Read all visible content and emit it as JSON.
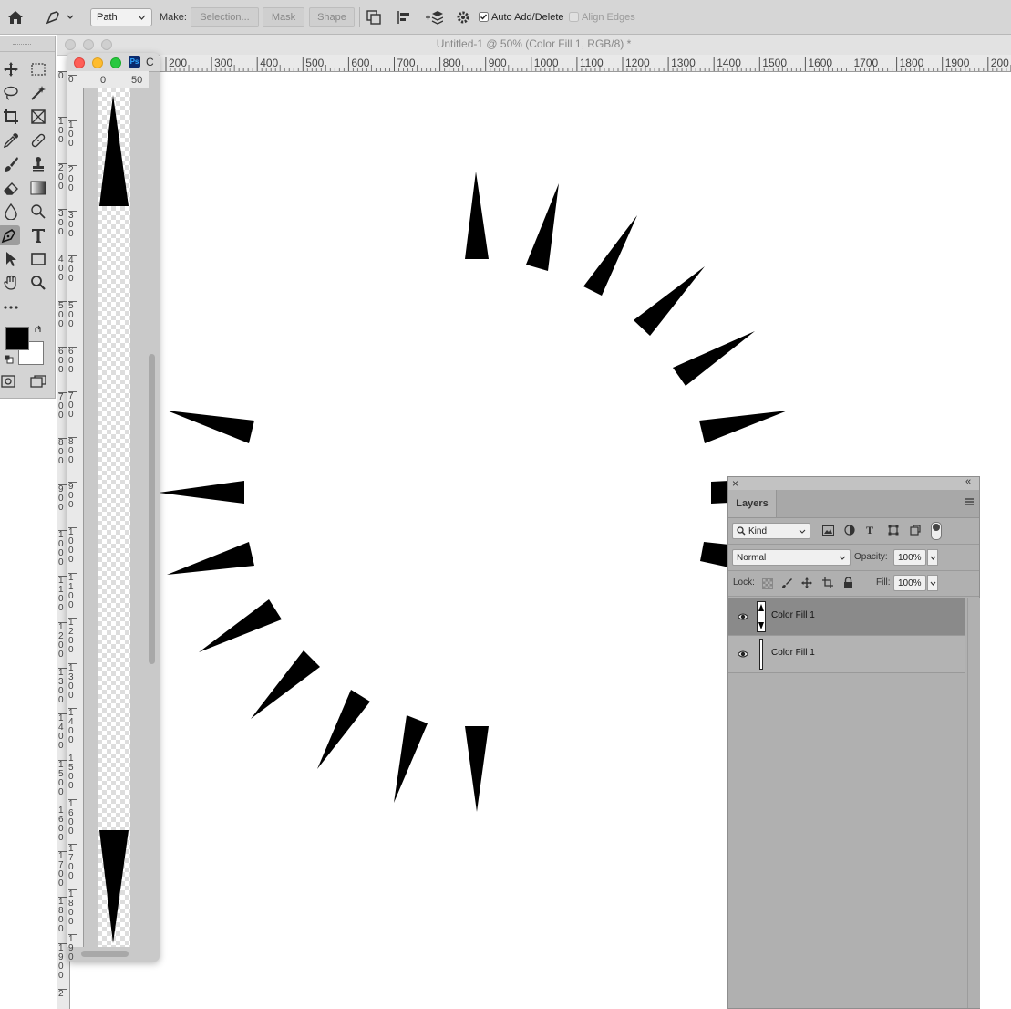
{
  "options_bar": {
    "mode_select": "Path",
    "make_label": "Make:",
    "selection_button": "Selection...",
    "mask_button": "Mask",
    "shape_button": "Shape",
    "auto_add_delete_label": "Auto Add/Delete",
    "auto_add_delete_checked": true,
    "align_edges_label": "Align Edges",
    "align_edges_checked": false
  },
  "document": {
    "title": "Untitled-1 @ 50% (Color Fill 1, RGB/8) *"
  },
  "ruler_top": {
    "ticks": [
      "200",
      "300",
      "400",
      "500",
      "600",
      "700",
      "800",
      "900",
      "1000",
      "1100",
      "1200",
      "1300",
      "1400",
      "1500",
      "1600",
      "1700",
      "1800",
      "1900",
      "200"
    ]
  },
  "ruler_left": {
    "ticks": [
      "0",
      "100",
      "200",
      "300",
      "400",
      "500",
      "600",
      "700",
      "800",
      "900",
      "1000",
      "1100",
      "1200",
      "1300",
      "1400",
      "1500",
      "1600",
      "1700",
      "1800",
      "1900",
      "2"
    ]
  },
  "floating_window": {
    "ps_badge": "Ps",
    "title_fragment": "C",
    "ruler_ticks": [
      "0",
      "50"
    ],
    "left_ruler_ticks": [
      "0",
      "100",
      "200",
      "300",
      "400",
      "500",
      "600",
      "700",
      "800",
      "900",
      "1000",
      "1100",
      "1200",
      "1300",
      "1400",
      "1500",
      "1600",
      "1700",
      "1800",
      "1900"
    ]
  },
  "layers_panel": {
    "tab": "Layers",
    "filter_kind": "Kind",
    "blend_mode": "Normal",
    "opacity_label": "Opacity:",
    "opacity_value": "100%",
    "lock_label": "Lock:",
    "fill_label": "Fill:",
    "fill_value": "100%",
    "layers": [
      {
        "name": "Color Fill 1",
        "selected": true
      },
      {
        "name": "Color Fill 1",
        "selected": false
      }
    ]
  },
  "colors": {
    "foreground": "#000000",
    "background": "#ffffff"
  }
}
